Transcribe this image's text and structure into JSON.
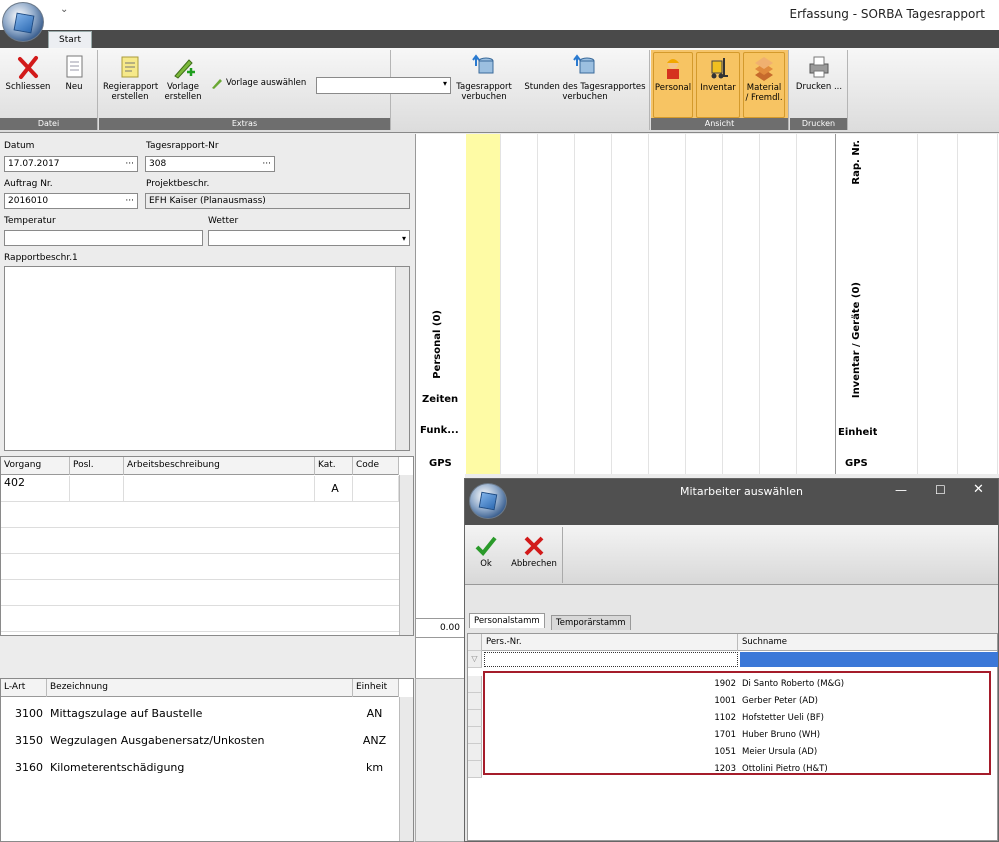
{
  "window": {
    "title": "Erfassung - SORBA Tagesrapport",
    "qat": "⌄"
  },
  "ribbon": {
    "tab": "Start",
    "groups": {
      "datei": "Datei",
      "extras": "Extras",
      "ansicht": "Ansicht",
      "drucken": "Drucken"
    },
    "buttons": {
      "schliessen": "Schliessen",
      "neu": "Neu",
      "regierapport": "Regierapport erstellen",
      "vorlage": "Vorlage erstellen",
      "vorlage_auswaehlen": "Vorlage auswählen",
      "tagesrapport_verbuchen": "Tagesrapport verbuchen",
      "stunden_verbuchen": "Stunden des Tagesrapportes verbuchen",
      "personal": "Personal",
      "inventar": "Inventar",
      "material": "Material / Fremdl.",
      "drucken": "Drucken ..."
    }
  },
  "form": {
    "datum_label": "Datum",
    "datum_value": "17.07.2017",
    "tagesrapport_label": "Tagesrapport-Nr",
    "tagesrapport_value": "308",
    "auftrag_label": "Auftrag Nr.",
    "auftrag_value": "2016010",
    "projekt_label": "Projektbeschr.",
    "projekt_value": "EFH Kaiser (Planausmass)",
    "temperatur_label": "Temperatur",
    "wetter_label": "Wetter",
    "rapportbeschr_label": "Rapportbeschr.1"
  },
  "vorgang": {
    "headers": [
      "Vorgang",
      "Posl.",
      "Arbeitsbeschreibung",
      "Kat.",
      "Code"
    ],
    "rows": [
      {
        "vorgang": "402",
        "kat": "A"
      }
    ]
  },
  "lart": {
    "headers": [
      "L-Art",
      "Bezeichnung",
      "Einheit"
    ],
    "rows": [
      {
        "lart": "3100",
        "bez": "Mittagszulage auf Baustelle",
        "einheit": "AN"
      },
      {
        "lart": "3150",
        "bez": "Wegzulagen Ausgabenersatz/Unkosten",
        "einheit": "ANZ"
      },
      {
        "lart": "3160",
        "bez": "Kilometerentschädigung",
        "einheit": "km"
      }
    ]
  },
  "schedule": {
    "personal": "Personal (0)",
    "zeiten": "Zeiten",
    "funk": "Funk...",
    "gps": "GPS",
    "rapnr": "Rap. Nr.",
    "inventar": "Inventar / Geräte (0)",
    "einheit": "Einheit",
    "gps2": "GPS",
    "total": "0.00"
  },
  "dialog": {
    "title": "Mitarbeiter auswählen",
    "ok": "Ok",
    "abbrechen": "Abbrechen",
    "tabs": [
      "Personalstamm",
      "Temporärstamm"
    ],
    "col_nr": "Pers.-Nr.",
    "col_name": "Suchname",
    "rows": [
      {
        "nr": "1902",
        "name": "Di Santo Roberto (M&G)"
      },
      {
        "nr": "1001",
        "name": "Gerber Peter (AD)"
      },
      {
        "nr": "1102",
        "name": "Hofstetter Ueli (BF)"
      },
      {
        "nr": "1701",
        "name": "Huber Bruno (WH)"
      },
      {
        "nr": "1051",
        "name": "Meier Ursula (AD)"
      },
      {
        "nr": "1203",
        "name": "Ottolini Pietro (H&T)"
      }
    ]
  }
}
